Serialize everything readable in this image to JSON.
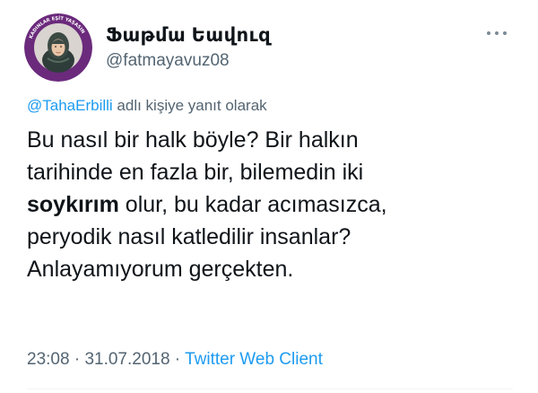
{
  "author": {
    "display_name": "Ֆաթմա Եավուզ",
    "handle": "@fatmayavuz08",
    "avatar_ring_text": "KADINLAR EŞİT YAŞASIN"
  },
  "reply_context": {
    "mention": "@TahaErbilli",
    "suffix": " adlı kişiye yanıt olarak"
  },
  "body": {
    "line1": "Bu nasıl bir halk böyle? Bir halkın",
    "line2": "tarihinde en fazla bir, bilemedin iki",
    "line3_bold": "soykırım",
    "line3_rest": " olur, bu kadar acımasızca,",
    "line4": "peryodik nasıl katledilir insanlar?",
    "line5": "Anlayamıyorum gerçekten."
  },
  "meta": {
    "time": "23:08",
    "separator": " · ",
    "date": "31.07.2018",
    "source": "Twitter Web Client"
  },
  "colors": {
    "link": "#1d9bf0",
    "secondary_text": "#536471",
    "primary_text": "#0f1419",
    "avatar_ring": "#6b2a7c"
  },
  "icons": {
    "more": "more-horizontal-icon",
    "avatar": "avatar"
  }
}
